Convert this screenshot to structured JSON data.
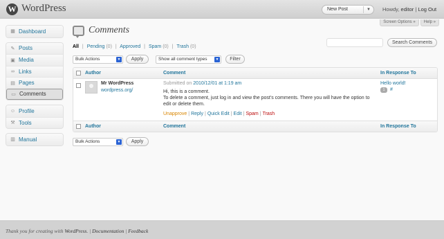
{
  "header": {
    "site_title": "WordPress",
    "logo_glyph": "W",
    "new_post_label": "New Post",
    "greeting": "Howdy, ",
    "username": "editor",
    "separator": " | ",
    "logout_label": "Log Out"
  },
  "screen_tabs": {
    "options_label": "Screen Options »",
    "help_label": "Help »"
  },
  "menu": {
    "group1": [
      {
        "label": "Dashboard",
        "icon": "dashboard-icon"
      }
    ],
    "group2": [
      {
        "label": "Posts",
        "icon": "pin-icon"
      },
      {
        "label": "Media",
        "icon": "media-icon"
      },
      {
        "label": "Links",
        "icon": "link-icon"
      },
      {
        "label": "Pages",
        "icon": "page-icon"
      },
      {
        "label": "Comments",
        "icon": "comment-icon",
        "current": true
      }
    ],
    "group3": [
      {
        "label": "Profile",
        "icon": "profile-icon"
      },
      {
        "label": "Tools",
        "icon": "tools-icon"
      }
    ],
    "group4": [
      {
        "label": "Manual",
        "icon": "manual-icon"
      }
    ]
  },
  "page": {
    "title": "Comments"
  },
  "status_links": {
    "all": "All",
    "pending": "Pending",
    "pending_count": "(0)",
    "approved": "Approved",
    "spam": "Spam",
    "spam_count": "(0)",
    "trash": "Trash",
    "trash_count": "(0)",
    "sep": "|"
  },
  "search": {
    "button_label": "Search Comments",
    "value": ""
  },
  "toolbar": {
    "bulk_actions": "Bulk Actions",
    "apply": "Apply",
    "comment_types": "Show all comment types",
    "filter": "Filter"
  },
  "table": {
    "columns": [
      "Author",
      "Comment",
      "In Response To"
    ],
    "rows": [
      {
        "author": "Mr WordPress",
        "author_url": "wordpress.org/",
        "submitted_prefix": "Submitted on ",
        "submitted_date": "2010/12/01 at 1:19 am",
        "text_line1": "Hi, this is a comment.",
        "text_line2": "To delete a comment, just log in and view the post's comments. There you will have the option to edit or delete them.",
        "actions": {
          "unapprove": "Unapprove",
          "reply": "Reply",
          "quick_edit": "Quick Edit",
          "edit": "Edit",
          "spam": "Spam",
          "trash": "Trash"
        },
        "response_post": "Hello world!",
        "comment_count": "1",
        "comment_link": "#"
      }
    ]
  },
  "footer": {
    "thanks": "Thank you for creating with ",
    "wordpress": "WordPress",
    "sep": ". | ",
    "documentation": "Documentation",
    "sep2": " | ",
    "feedback": "Feedback"
  }
}
